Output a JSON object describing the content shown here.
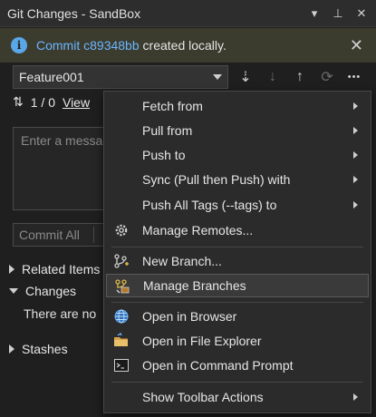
{
  "window": {
    "title": "Git Changes - SandBox",
    "dropdown_glyph": "▾",
    "pin_glyph": "⊥",
    "close_glyph": "✕"
  },
  "infobar": {
    "prefix": "Commit",
    "commit_id": "c89348bb",
    "suffix": "created locally.",
    "icon_text": "i",
    "close_glyph": "✕"
  },
  "branch": {
    "selected": "Feature001"
  },
  "toolbar": {
    "icons": [
      "fetch-icon",
      "pull-icon",
      "push-icon",
      "sync-icon",
      "more-icon"
    ],
    "fetch_glyph": "⇣",
    "pull_glyph": "↓",
    "push_glyph": "↑",
    "sync_glyph": "⟳",
    "more_glyph": "•••"
  },
  "sync_status": {
    "arrows": "⇅",
    "counts": "1 / 0",
    "view_link": "View"
  },
  "commit": {
    "message_placeholder": "Enter a message",
    "commit_all_label": "Commit All"
  },
  "sections": {
    "related_items": "Related Items",
    "changes": "Changes",
    "no_changes_text": "There are no",
    "stashes": "Stashes"
  },
  "menu": {
    "items": [
      {
        "label": "Fetch from",
        "submenu": true
      },
      {
        "label": "Pull from",
        "submenu": true
      },
      {
        "label": "Push to",
        "submenu": true
      },
      {
        "label": "Sync (Pull then Push) with",
        "submenu": true
      },
      {
        "label": "Push All Tags (--tags) to",
        "submenu": true
      },
      {
        "label": "Manage Remotes...",
        "icon": "gear-icon"
      },
      {
        "label": "New Branch...",
        "icon": "new-branch-icon"
      },
      {
        "label": "Manage Branches",
        "icon": "manage-branches-icon",
        "selected": true
      },
      {
        "label": "Open in Browser",
        "icon": "globe-icon"
      },
      {
        "label": "Open in File Explorer",
        "icon": "folder-icon"
      },
      {
        "label": "Open in Command Prompt",
        "icon": "terminal-icon"
      },
      {
        "label": "Show Toolbar Actions",
        "submenu": true
      }
    ]
  },
  "colors": {
    "background": "#1f1f1f",
    "infobar": "#3b3b2e",
    "link": "#6cb6ff",
    "menu": "#2b2b2b"
  }
}
